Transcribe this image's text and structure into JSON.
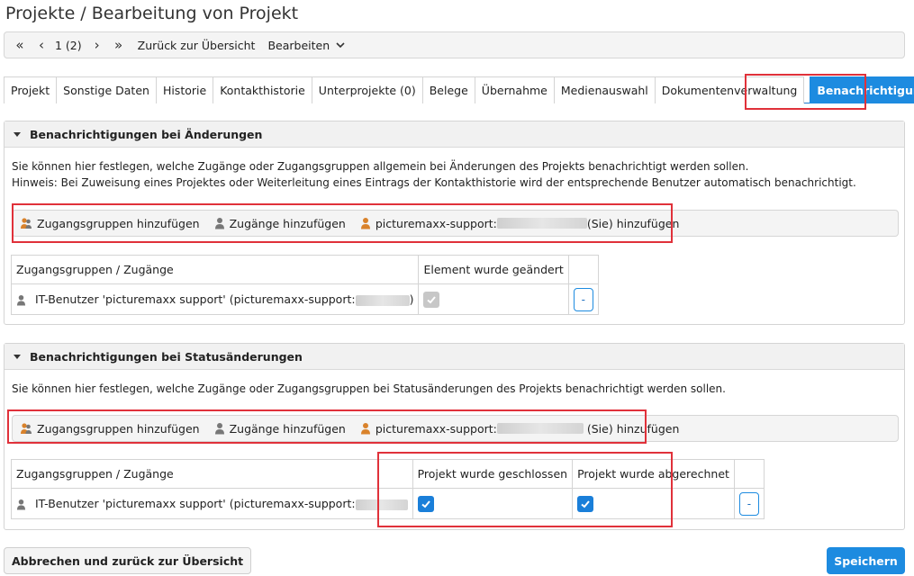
{
  "page": {
    "title": "Projekte / Bearbeitung von Projekt"
  },
  "toolbar": {
    "first_icon": "first-page-icon",
    "prev_icon": "prev-icon",
    "page_indicator": "1 (2)",
    "next_icon": "next-icon",
    "last_icon": "last-page-icon",
    "back_label": "Zurück zur Übersicht",
    "edit_label": "Bearbeiten"
  },
  "tabs": [
    {
      "label": "Projekt"
    },
    {
      "label": "Sonstige Daten"
    },
    {
      "label": "Historie"
    },
    {
      "label": "Kontakthistorie"
    },
    {
      "label": "Unterprojekte (0)"
    },
    {
      "label": "Belege"
    },
    {
      "label": "Übernahme"
    },
    {
      "label": "Medienauswahl"
    },
    {
      "label": "Dokumentenverwaltung"
    },
    {
      "label": "Benachrichtigungen",
      "active": true
    }
  ],
  "section1": {
    "header": "Benachrichtigungen bei Änderungen",
    "desc_line1": "Sie können hier festlegen, welche Zugänge oder Zugangsgruppen allgemein bei Änderungen des Projekts benachrichtigt werden sollen.",
    "desc_line2": "Hinweis: Bei Zuweisung eines Projektes oder Weiterleitung eines Eintrags der Kontakthistorie wird der entsprechende Benutzer automatisch benachrichtigt.",
    "actions": {
      "add_groups": "Zugangsgruppen hinzufügen",
      "add_users": "Zugänge hinzufügen",
      "add_self_prefix": "picturemaxx-support:",
      "add_self_suffix": "(Sie) hinzufügen"
    },
    "table": {
      "col_name": "Zugangsgruppen / Zugänge",
      "col_changed": "Element wurde geändert",
      "rows": [
        {
          "name": "IT-Benutzer 'picturemaxx support' (picturemaxx-support:",
          "name_end": ")",
          "changed": true,
          "remove_label": "-"
        }
      ]
    }
  },
  "section2": {
    "header": "Benachrichtigungen bei Statusänderungen",
    "desc_line1": "Sie können hier festlegen, welche Zugänge oder Zugangsgruppen bei Statusänderungen des Projekts benachrichtigt werden sollen.",
    "actions": {
      "add_groups": "Zugangsgruppen hinzufügen",
      "add_users": "Zugänge hinzufügen",
      "add_self_prefix": "picturemaxx-support:",
      "add_self_suffix": "(Sie) hinzufügen"
    },
    "table": {
      "col_name": "Zugangsgruppen / Zugänge",
      "col_closed": "Projekt wurde geschlossen",
      "col_billed": "Projekt wurde abgerechnet",
      "rows": [
        {
          "name": "IT-Benutzer 'picturemaxx support' (picturemaxx-support:",
          "closed": true,
          "billed": true,
          "remove_label": "-"
        }
      ]
    }
  },
  "footer": {
    "cancel_label": "Abbrechen und zurück zur Übersicht",
    "save_label": "Speichern"
  },
  "colors": {
    "accent": "#1d8be0",
    "highlight": "#e0313a",
    "checkbox_on": "#1a7fd9",
    "checkbox_disabled": "#c7c7c7"
  }
}
